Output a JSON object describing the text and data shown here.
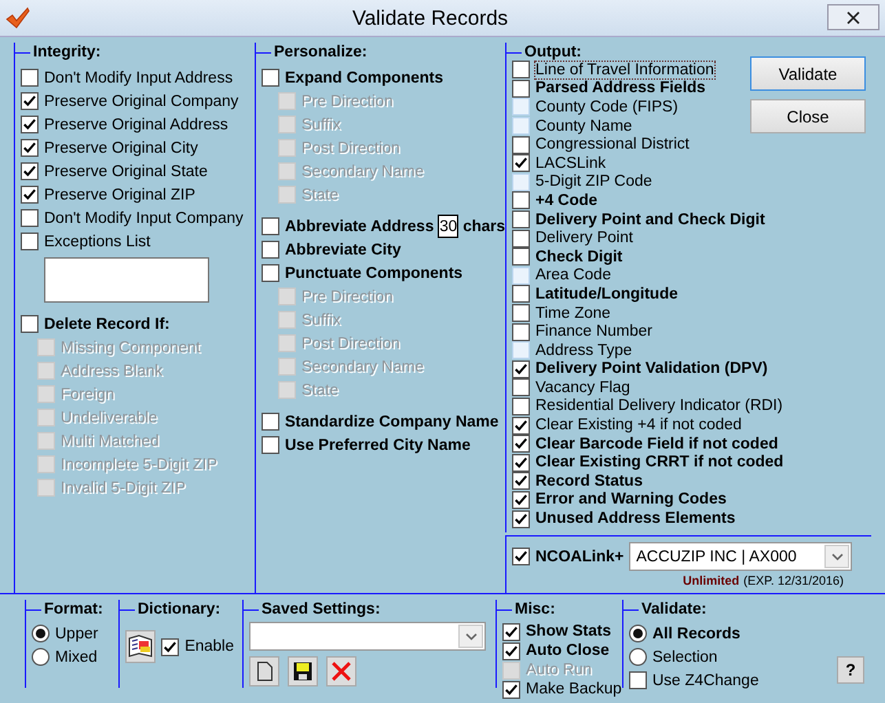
{
  "window": {
    "title": "Validate Records"
  },
  "integrity": {
    "title": "Integrity:",
    "items": [
      {
        "kind": "check",
        "label": "Don't Modify Input Address",
        "checked": false,
        "disabled": false,
        "bold": false
      },
      {
        "kind": "check",
        "label": "Preserve Original Company",
        "checked": true,
        "disabled": false,
        "bold": false
      },
      {
        "kind": "check",
        "label": "Preserve Original Address",
        "checked": true,
        "disabled": false,
        "bold": false
      },
      {
        "kind": "check",
        "label": "Preserve Original City",
        "checked": true,
        "disabled": false,
        "bold": false
      },
      {
        "kind": "check",
        "label": "Preserve Original State",
        "checked": true,
        "disabled": false,
        "bold": false
      },
      {
        "kind": "check",
        "label": "Preserve Original ZIP",
        "checked": true,
        "disabled": false,
        "bold": false
      },
      {
        "kind": "check",
        "label": "Don't Modify Input Company",
        "checked": false,
        "disabled": false,
        "bold": false
      },
      {
        "kind": "check",
        "label": "Exceptions List",
        "checked": false,
        "disabled": false,
        "bold": false
      },
      {
        "kind": "listbox"
      },
      {
        "kind": "check",
        "label": "Delete Record If:",
        "checked": false,
        "disabled": false,
        "bold": true
      },
      {
        "kind": "sub",
        "label": "Missing Component",
        "checked": false,
        "disabled": true,
        "bold": false
      },
      {
        "kind": "sub",
        "label": "Address Blank",
        "checked": false,
        "disabled": true,
        "bold": false
      },
      {
        "kind": "sub",
        "label": "Foreign",
        "checked": false,
        "disabled": true,
        "bold": false
      },
      {
        "kind": "sub",
        "label": "Undeliverable",
        "checked": false,
        "disabled": true,
        "bold": false
      },
      {
        "kind": "sub",
        "label": "Multi Matched",
        "checked": false,
        "disabled": true,
        "bold": false
      },
      {
        "kind": "sub",
        "label": "Incomplete 5-Digit ZIP",
        "checked": false,
        "disabled": true,
        "bold": false
      },
      {
        "kind": "sub",
        "label": "Invalid 5-Digit ZIP",
        "checked": false,
        "disabled": true,
        "bold": false
      }
    ]
  },
  "personalize": {
    "title": "Personalize:",
    "items": [
      {
        "kind": "check",
        "label": "Expand Components",
        "checked": false,
        "disabled": false,
        "bold": true
      },
      {
        "kind": "sub",
        "label": "Pre Direction",
        "checked": false,
        "disabled": true,
        "bold": false
      },
      {
        "kind": "sub",
        "label": "Suffix",
        "checked": false,
        "disabled": true,
        "bold": false
      },
      {
        "kind": "sub",
        "label": "Post Direction",
        "checked": false,
        "disabled": true,
        "bold": false
      },
      {
        "kind": "sub",
        "label": "Secondary Name",
        "checked": false,
        "disabled": true,
        "bold": false
      },
      {
        "kind": "sub",
        "label": "State",
        "checked": false,
        "disabled": true,
        "bold": false
      },
      {
        "kind": "check-input",
        "label": "Abbreviate Address",
        "value": "30",
        "suffix": "chars",
        "checked": false,
        "disabled": false,
        "bold": true
      },
      {
        "kind": "check",
        "label": "Abbreviate City",
        "checked": false,
        "disabled": false,
        "bold": true
      },
      {
        "kind": "check",
        "label": "Punctuate Components",
        "checked": false,
        "disabled": false,
        "bold": true
      },
      {
        "kind": "sub",
        "label": "Pre Direction",
        "checked": false,
        "disabled": true,
        "bold": false
      },
      {
        "kind": "sub",
        "label": "Suffix",
        "checked": false,
        "disabled": true,
        "bold": false
      },
      {
        "kind": "sub",
        "label": "Post Direction",
        "checked": false,
        "disabled": true,
        "bold": false
      },
      {
        "kind": "sub",
        "label": "Secondary Name",
        "checked": false,
        "disabled": true,
        "bold": false
      },
      {
        "kind": "sub",
        "label": "State",
        "checked": false,
        "disabled": true,
        "bold": false
      },
      {
        "kind": "check",
        "label": "Standardize Company Name",
        "checked": false,
        "disabled": false,
        "bold": true
      },
      {
        "kind": "check",
        "label": "Use Preferred City Name",
        "checked": false,
        "disabled": false,
        "bold": true
      }
    ]
  },
  "output": {
    "title": "Output:",
    "items": [
      {
        "label": "Line of Travel Information",
        "checked": false,
        "bold": false,
        "tinted": false,
        "focused": true
      },
      {
        "label": "Parsed Address Fields",
        "checked": false,
        "bold": true,
        "tinted": false,
        "focused": false
      },
      {
        "label": "County Code (FIPS)",
        "checked": false,
        "bold": false,
        "tinted": true,
        "focused": false
      },
      {
        "label": "County Name",
        "checked": false,
        "bold": false,
        "tinted": true,
        "focused": false
      },
      {
        "label": "Congressional District",
        "checked": false,
        "bold": false,
        "tinted": false,
        "focused": false
      },
      {
        "label": "LACSLink",
        "checked": true,
        "bold": false,
        "tinted": false,
        "focused": false
      },
      {
        "label": "5-Digit ZIP Code",
        "checked": false,
        "bold": false,
        "tinted": true,
        "focused": false
      },
      {
        "label": "+4 Code",
        "checked": false,
        "bold": true,
        "tinted": false,
        "focused": false
      },
      {
        "label": "Delivery Point and Check Digit",
        "checked": false,
        "bold": true,
        "tinted": false,
        "focused": false
      },
      {
        "label": "Delivery Point",
        "checked": false,
        "bold": false,
        "tinted": false,
        "focused": false
      },
      {
        "label": "Check Digit",
        "checked": false,
        "bold": true,
        "tinted": false,
        "focused": false
      },
      {
        "label": "Area Code",
        "checked": false,
        "bold": false,
        "tinted": true,
        "focused": false
      },
      {
        "label": "Latitude/Longitude",
        "checked": false,
        "bold": true,
        "tinted": false,
        "focused": false
      },
      {
        "label": "Time Zone",
        "checked": false,
        "bold": false,
        "tinted": false,
        "focused": false
      },
      {
        "label": "Finance Number",
        "checked": false,
        "bold": false,
        "tinted": false,
        "focused": false
      },
      {
        "label": "Address Type",
        "checked": false,
        "bold": false,
        "tinted": true,
        "focused": false
      },
      {
        "label": "Delivery Point Validation (DPV)",
        "checked": true,
        "bold": true,
        "tinted": false,
        "focused": false
      },
      {
        "label": "Vacancy Flag",
        "checked": false,
        "bold": false,
        "tinted": false,
        "focused": false
      },
      {
        "label": "Residential Delivery Indicator (RDI)",
        "checked": false,
        "bold": false,
        "tinted": false,
        "focused": false
      },
      {
        "label": "Clear Existing +4 if not coded",
        "checked": true,
        "bold": false,
        "tinted": false,
        "focused": false
      },
      {
        "label": "Clear Barcode Field if not coded",
        "checked": true,
        "bold": true,
        "tinted": false,
        "focused": false
      },
      {
        "label": "Clear Existing CRRT if not coded",
        "checked": true,
        "bold": true,
        "tinted": false,
        "focused": false
      },
      {
        "label": "Record Status",
        "checked": true,
        "bold": true,
        "tinted": false,
        "focused": false
      },
      {
        "label": "Error and Warning Codes",
        "checked": true,
        "bold": true,
        "tinted": false,
        "focused": false
      },
      {
        "label": "Unused Address Elements",
        "checked": true,
        "bold": true,
        "tinted": false,
        "focused": false
      }
    ],
    "buttons": [
      {
        "label": "Validate",
        "default": true
      },
      {
        "label": "Close",
        "default": false
      }
    ],
    "ncoa": {
      "label": "NCOALink+",
      "checked": true,
      "value": "ACCUZIP INC | AX000",
      "license": "Unlimited",
      "expiry": "(EXP. 12/31/2016)"
    }
  },
  "format": {
    "title": "Format:",
    "options": [
      {
        "label": "Upper",
        "selected": true,
        "bold": false
      },
      {
        "label": "Mixed",
        "selected": false,
        "bold": false
      }
    ]
  },
  "dictionary": {
    "title": "Dictionary:",
    "enable": {
      "label": "Enable",
      "checked": true
    }
  },
  "saved_settings": {
    "title": "Saved Settings:"
  },
  "misc": {
    "title": "Misc:",
    "items": [
      {
        "label": "Show Stats",
        "checked": true,
        "disabled": false,
        "bold": true
      },
      {
        "label": "Auto Close",
        "checked": true,
        "disabled": false,
        "bold": true
      },
      {
        "label": "Auto Run",
        "checked": false,
        "disabled": true,
        "bold": false
      },
      {
        "label": "Make Backup",
        "checked": true,
        "disabled": false,
        "bold": false
      }
    ]
  },
  "validate": {
    "title": "Validate:",
    "options": [
      {
        "label": "All Records",
        "selected": true,
        "bold": true
      },
      {
        "label": "Selection",
        "selected": false,
        "bold": false
      }
    ],
    "z4change": {
      "label": "Use Z4Change",
      "checked": false
    }
  },
  "help": {
    "label": "?"
  }
}
